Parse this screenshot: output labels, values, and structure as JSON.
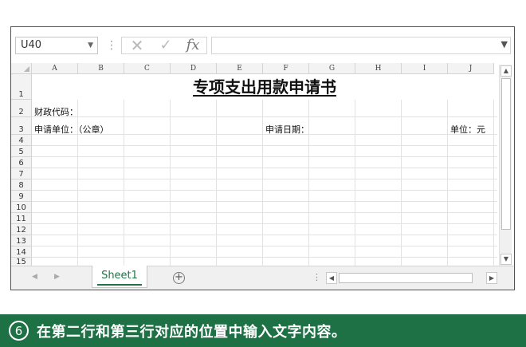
{
  "formula_bar": {
    "name_box": "U40",
    "dots": "⋮",
    "cancel_glyph": "✕",
    "enter_glyph": "✓",
    "fx_label": "fx",
    "formula_value": ""
  },
  "columns": [
    "A",
    "B",
    "C",
    "D",
    "E",
    "F",
    "G",
    "H",
    "I",
    "J"
  ],
  "rows": [
    "1",
    "2",
    "3",
    "4",
    "5",
    "6",
    "7",
    "8",
    "9",
    "10",
    "11",
    "12",
    "13",
    "14",
    "15"
  ],
  "cells": {
    "title": "专项支出用款申请书",
    "a2": "财政代码：",
    "a3": "申请单位：（公章）",
    "f3": "申请日期：",
    "j3": "单位：元"
  },
  "sheet_tabs": {
    "active": "Sheet1"
  },
  "caption": {
    "step": "6",
    "text": "在第二行和第三行对应的位置中输入文字内容。"
  },
  "colors": {
    "accent": "#1e7145",
    "tab_text": "#217346"
  }
}
